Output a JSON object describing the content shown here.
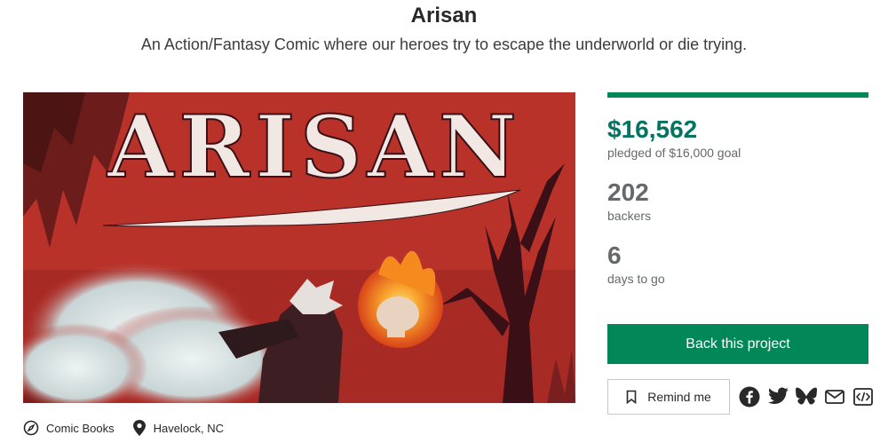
{
  "project": {
    "title": "Arisan",
    "subtitle": "An Action/Fantasy Comic where our heroes try to escape the underworld or die trying."
  },
  "hero_image": {
    "logo_text": "ARISAN",
    "colors": {
      "background": "#b8322a",
      "fire": "#f06a1c",
      "smoke": "#dfe7e8"
    }
  },
  "meta": {
    "category": "Comic Books",
    "location": "Havelock, NC"
  },
  "stats": {
    "funded_fraction": 1.0,
    "pledged": "$16,562",
    "pledged_label": "pledged of $16,000 goal",
    "backers": "202",
    "backers_label": "backers",
    "days": "6",
    "days_label": "days to go"
  },
  "actions": {
    "back_label": "Back this project",
    "remind_label": "Remind me"
  },
  "share_icons": [
    "facebook-icon",
    "twitter-icon",
    "bluesky-icon",
    "email-icon",
    "embed-icon"
  ],
  "colors": {
    "accent": "#028858",
    "pledged": "#037362",
    "muted": "#656969"
  }
}
